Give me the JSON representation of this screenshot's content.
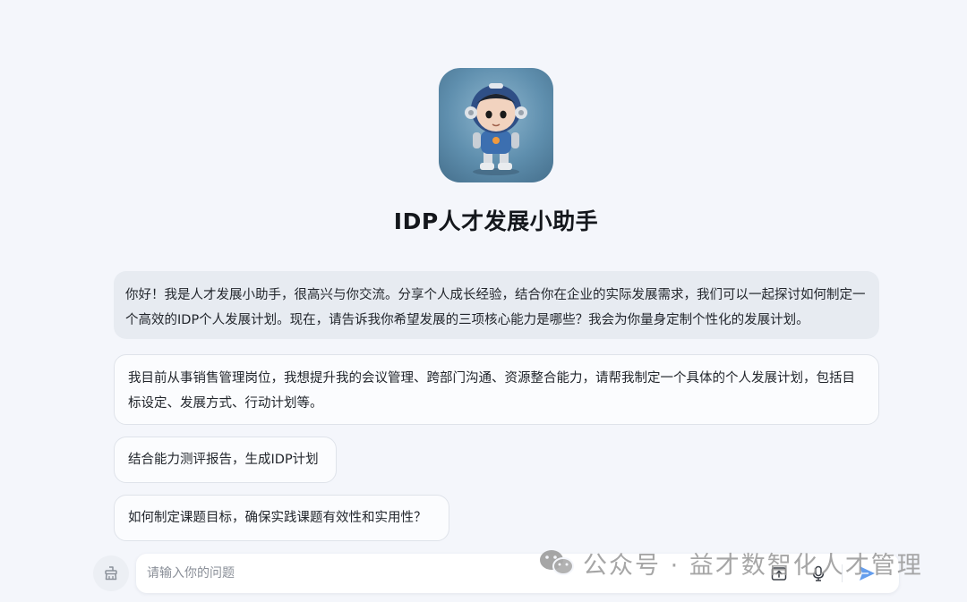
{
  "assistant": {
    "title": "IDP人才发展小助手",
    "greeting": "你好！我是人才发展小助手，很高兴与你交流。分享个人成长经验，结合你在企业的实际发展需求，我们可以一起探讨如何制定一个高效的IDP个人发展计划。现在，请告诉我你希望发展的三项核心能力是哪些？我会为你量身定制个性化的发展计划。"
  },
  "suggestions": [
    "我目前从事销售管理岗位，我想提升我的会议管理、跨部门沟通、资源整合能力，请帮我制定一个具体的个人发展计划，包括目标设定、发展方式、行动计划等。",
    "结合能力测评报告，生成IDP计划",
    "如何制定课题目标，确保实践课题有效性和实用性？"
  ],
  "input": {
    "placeholder": "请输入你的问题",
    "value": ""
  },
  "icons": {
    "clear": "broom-icon",
    "upload": "upload-icon",
    "mic": "microphone-icon",
    "send": "send-icon"
  },
  "watermark": {
    "text": "公众号 · 益才数智化人才管理"
  },
  "colors": {
    "background": "#f4f6fb",
    "greeting_bubble": "#e7ebf1",
    "send_accent": "#4a8dea"
  }
}
